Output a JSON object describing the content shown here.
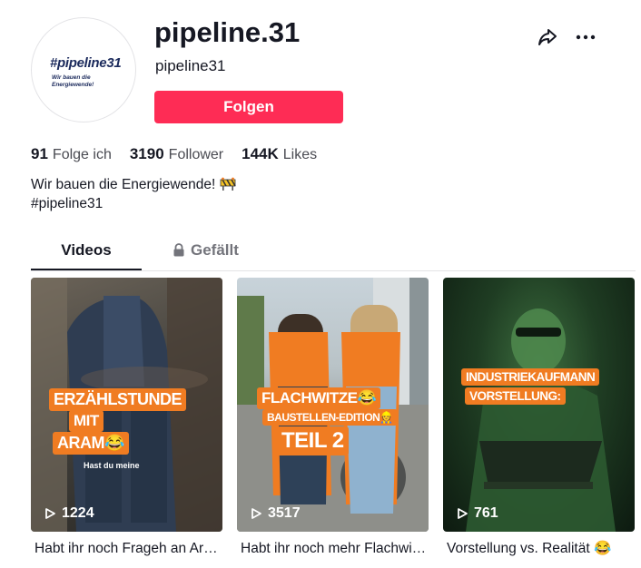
{
  "profile": {
    "avatar_logo_text": "#pipeline31",
    "avatar_logo_sub": "Wir bauen die Energiewende!",
    "username": "pipeline.31",
    "nickname": "pipeline31",
    "follow_label": "Folgen",
    "accent_color": "#fe2c55"
  },
  "stats": {
    "following_count": "91",
    "following_label": "Folge ich",
    "followers_count": "3190",
    "followers_label": "Follower",
    "likes_count": "144K",
    "likes_label": "Likes"
  },
  "bio": {
    "line1": "Wir bauen die Energiewende!",
    "line2": "#pipeline31"
  },
  "tabs": {
    "videos": "Videos",
    "liked": "Gefällt"
  },
  "videos": [
    {
      "views": "1224",
      "caption": "Habt ihr noch Frageh an Aram? #…",
      "overlay_line1": "ERZÄHLSTUNDE",
      "overlay_line2": "MIT",
      "overlay_line3": "ARAM😂",
      "overlay_sub": "Hast du meine"
    },
    {
      "views": "3517",
      "caption": "Habt ihr noch mehr Flachwitze? #…",
      "overlay_line1": "FLACHWITZE😂",
      "overlay_line2": "BAUSTELLEN-EDITION👷",
      "overlay_line3": "TEIL 2"
    },
    {
      "views": "761",
      "caption": "Vorstellung vs. Realität 😂",
      "overlay_line1": "INDUSTRIEKAUFMANN",
      "overlay_line2": "VORSTELLUNG:"
    }
  ]
}
